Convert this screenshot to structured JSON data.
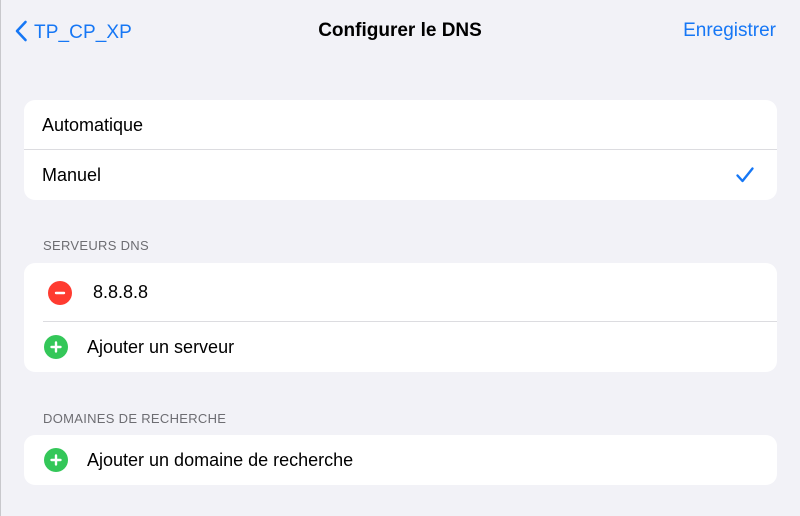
{
  "navbar": {
    "back_label": "TP_CP_XP",
    "title": "Configurer le DNS",
    "save_label": "Enregistrer"
  },
  "mode": {
    "options": [
      {
        "label": "Automatique",
        "selected": false
      },
      {
        "label": "Manuel",
        "selected": true
      }
    ]
  },
  "dns_servers": {
    "header": "SERVEURS DNS",
    "entries": [
      "8.8.8.8"
    ],
    "add_label": "Ajouter un serveur"
  },
  "search_domains": {
    "header": "DOMAINES DE RECHERCHE",
    "add_label": "Ajouter un domaine de recherche"
  },
  "colors": {
    "accent": "#1677f5",
    "background": "#f2f2f7",
    "remove": "#ff3b30",
    "add": "#34c759"
  }
}
